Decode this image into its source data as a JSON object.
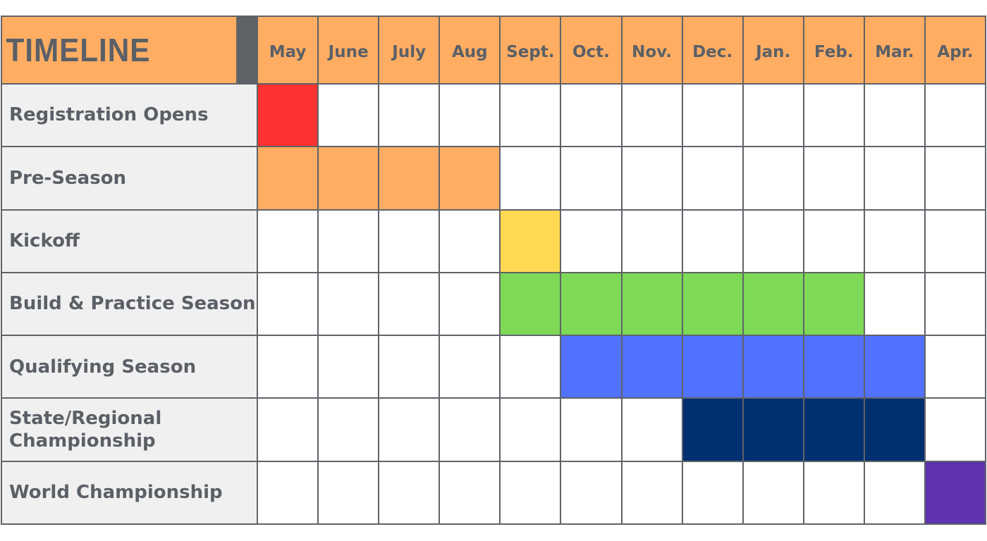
{
  "chart_data": {
    "type": "table",
    "title": "TIMELINE",
    "months": [
      "May",
      "June",
      "July",
      "Aug",
      "Sept.",
      "Oct.",
      "Nov.",
      "Dec.",
      "Jan.",
      "Feb.",
      "Mar.",
      "Apr."
    ],
    "tasks": [
      {
        "name": "Registration Opens",
        "start": "May",
        "end": "May",
        "color": "#ff3131"
      },
      {
        "name": "Pre-Season",
        "start": "May",
        "end": "Aug",
        "color": "#ffad62"
      },
      {
        "name": "Kickoff",
        "start": "Sept.",
        "end": "Sept.",
        "color": "#ffd952"
      },
      {
        "name": "Build & Practice Season",
        "start": "Sept.",
        "end": "Feb.",
        "color": "#7ed957"
      },
      {
        "name": "Qualifying Season",
        "start": "Oct.",
        "end": "Mar.",
        "color": "#5271ff"
      },
      {
        "name": "State/Regional Championship",
        "start": "Dec.",
        "end": "Mar.",
        "color": "#003070"
      },
      {
        "name": "World Championship",
        "start": "Apr.",
        "end": "Apr.",
        "color": "#5e32b0"
      }
    ]
  },
  "colors": {
    "header_bg": "#ffad62",
    "label_bg": "#f0f0f0",
    "text": "#5b6067",
    "grid": "#5f6368"
  }
}
